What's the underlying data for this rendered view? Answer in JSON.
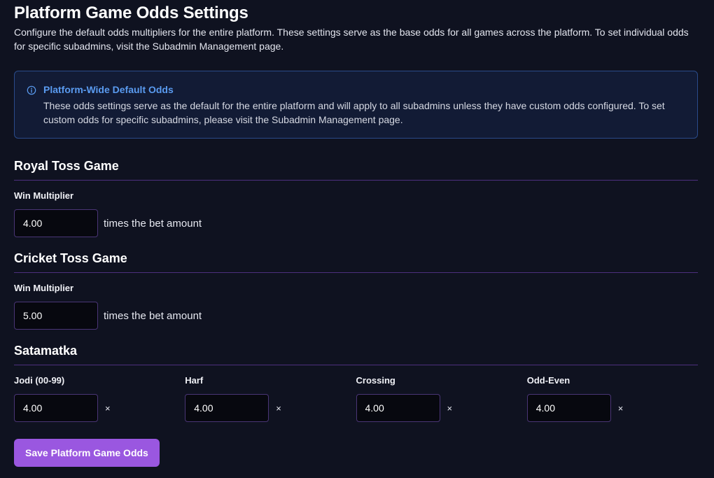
{
  "header": {
    "title": "Platform Game Odds Settings",
    "description": "Configure the default odds multipliers for the entire platform. These settings serve as the base odds for all games across the platform. To set individual odds for specific subadmins, visit the Subadmin Management page."
  },
  "info": {
    "icon": "info-circle-icon",
    "title": "Platform-Wide Default Odds",
    "text": "These odds settings serve as the default for the entire platform and will apply to all subadmins unless they have custom odds configured. To set custom odds for specific subadmins, please visit the Subadmin Management page."
  },
  "royal_toss": {
    "title": "Royal Toss Game",
    "label": "Win Multiplier",
    "value": "4.00",
    "suffix": "times the bet amount"
  },
  "cricket_toss": {
    "title": "Cricket Toss Game",
    "label": "Win Multiplier",
    "value": "5.00",
    "suffix": "times the bet amount"
  },
  "satamatka": {
    "title": "Satamatka",
    "fields": [
      {
        "label": "Jodi (00-99)",
        "value": "4.00",
        "suffix": "×"
      },
      {
        "label": "Harf",
        "value": "4.00",
        "suffix": "×"
      },
      {
        "label": "Crossing",
        "value": "4.00",
        "suffix": "×"
      },
      {
        "label": "Odd-Even",
        "value": "4.00",
        "suffix": "×"
      }
    ]
  },
  "actions": {
    "save_label": "Save Platform Game Odds"
  },
  "colors": {
    "background": "#0f1220",
    "accent": "#9a57e0",
    "info_title": "#5a9bf0",
    "info_border": "#2a4b8a",
    "divider": "#4d2f7e"
  }
}
